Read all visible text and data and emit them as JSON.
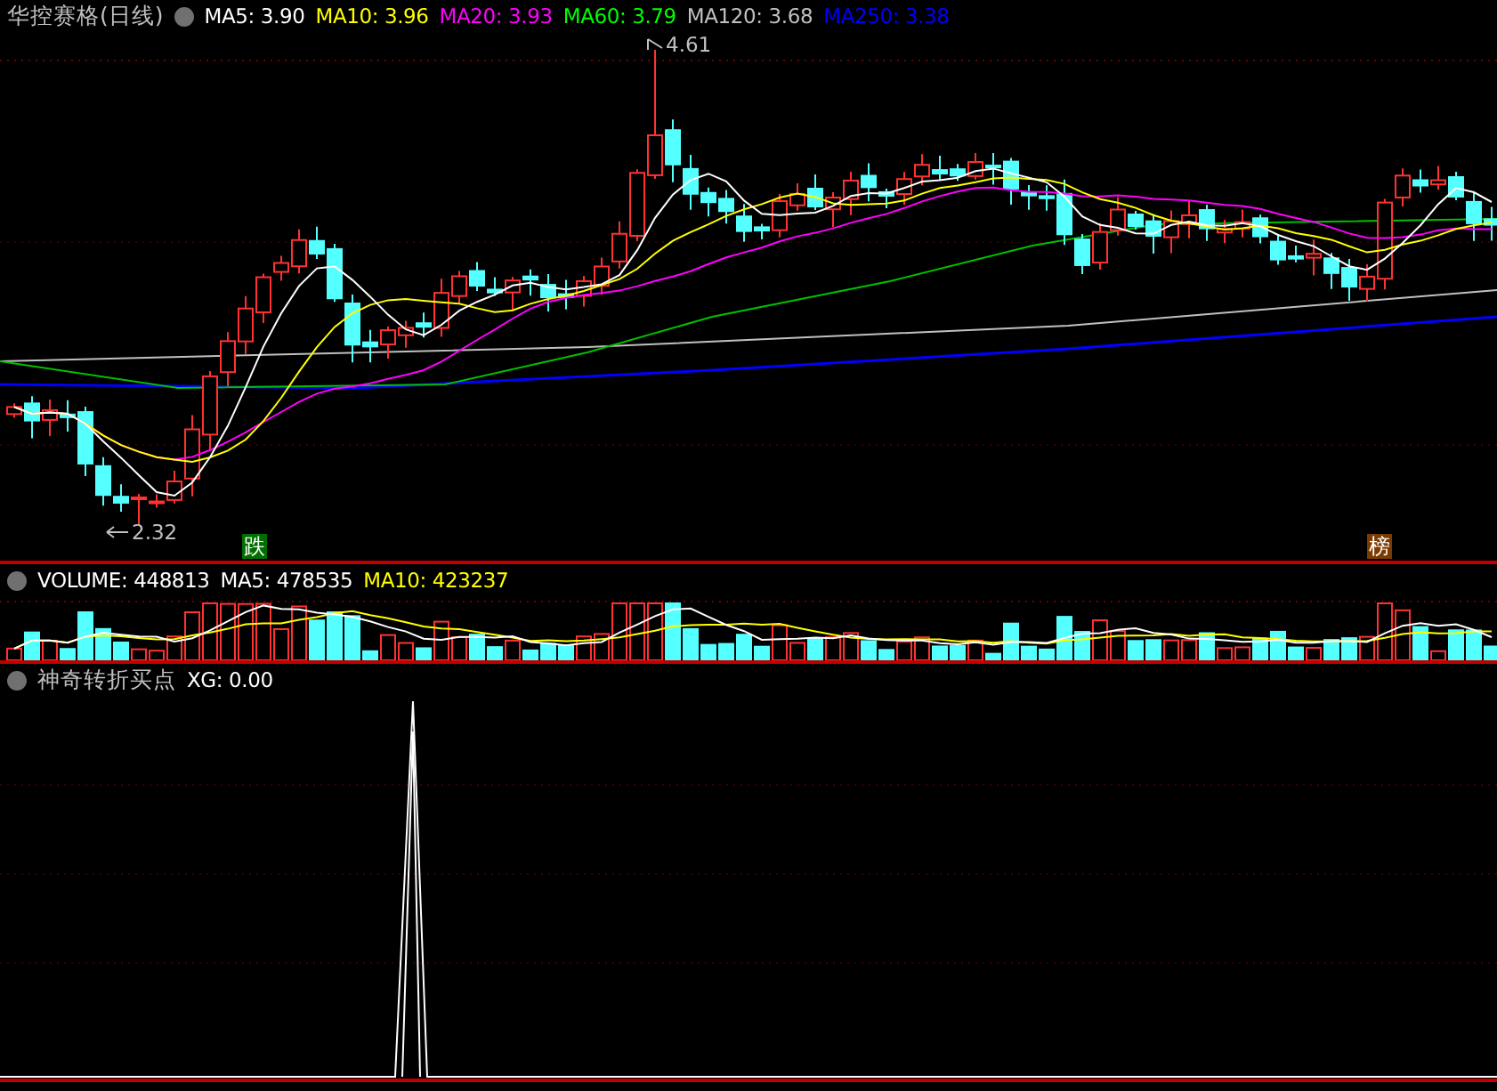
{
  "main_panel": {
    "title": "华控赛格(日线)",
    "indicators": [
      {
        "label": "MA5: 3.90",
        "color": "#ffffff"
      },
      {
        "label": "MA10: 3.96",
        "color": "#ffff00"
      },
      {
        "label": "MA20: 3.93",
        "color": "#ff00ff"
      },
      {
        "label": "MA60: 3.79",
        "color": "#00ff00"
      },
      {
        "label": "MA120: 3.68",
        "color": "#c0c0c0"
      },
      {
        "label": "MA250: 3.38",
        "color": "#0000ff"
      }
    ],
    "high_label": "4.61",
    "low_label": "2.32",
    "markers": [
      {
        "text": "跌",
        "color": "#006e00"
      },
      {
        "text": "榜",
        "color": "#7a3a00"
      }
    ]
  },
  "volume_panel": {
    "indicators": [
      {
        "label": "VOLUME: 448813",
        "color": "#ffffff"
      },
      {
        "label": "MA5: 478535",
        "color": "#ffffff"
      },
      {
        "label": "MA10: 423237",
        "color": "#ffff00"
      }
    ]
  },
  "signal_panel": {
    "title": "神奇转折买点",
    "indicators": [
      {
        "label": "XG: 0.00",
        "color": "#ffffff"
      }
    ]
  }
}
